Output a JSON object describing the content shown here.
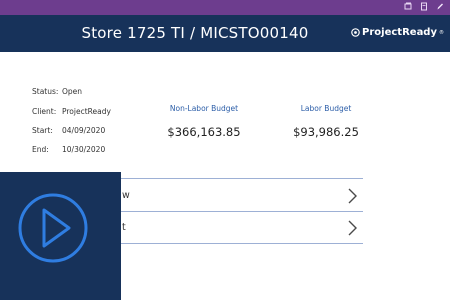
{
  "titlebar": {
    "color": "#6d3d8e",
    "icons": [
      "restore-icon",
      "page-icon",
      "edit-icon"
    ]
  },
  "header": {
    "title": "Store 1725 TI / MICSTO00140",
    "brand": "ProjectReady",
    "brand_mark": "®",
    "background": "#17325a"
  },
  "details": {
    "status_label": "Status:",
    "status_value": "Open",
    "client_label": "Client:",
    "client_value": "ProjectReady",
    "start_label": "Start:",
    "start_value": "04/09/2020",
    "end_label": "End:",
    "end_value": "10/30/2020"
  },
  "budgets": {
    "non_labor_label": "Non-Labor Budget",
    "non_labor_value": "$366,163.85",
    "labor_label": "Labor Budget",
    "labor_value": "$93,986.25"
  },
  "nav_rows": [
    {
      "label": "w",
      "icon": "chevron-right-icon"
    },
    {
      "label": "t",
      "icon": "chevron-right-icon"
    }
  ],
  "video_overlay": {
    "icon": "play-icon",
    "background": "#17325a",
    "accent": "#2f7de1"
  }
}
